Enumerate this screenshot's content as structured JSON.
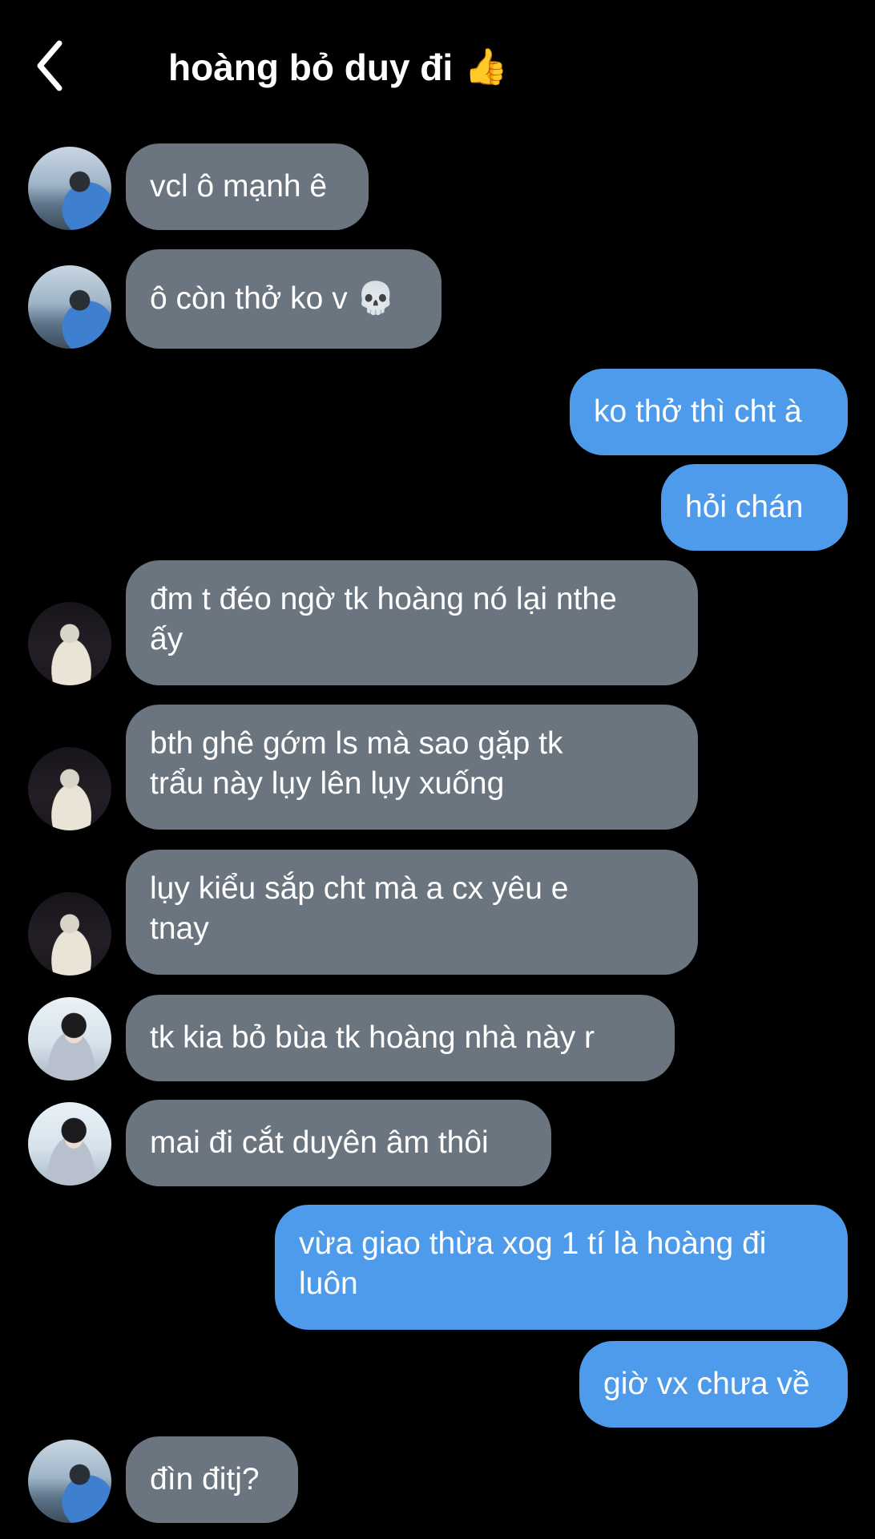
{
  "header": {
    "title": "hoàng bỏ duy đi",
    "title_emoji": "👍",
    "back_icon": "chevron-left-icon"
  },
  "colors": {
    "background": "#000000",
    "incoming_bubble": "#6b7580",
    "outgoing_bubble": "#4d9bea",
    "text": "#ffffff"
  },
  "messages": [
    {
      "side": "in",
      "avatar": "avatar-person-1",
      "text": "vcl ô mạnh ê"
    },
    {
      "side": "in",
      "avatar": "avatar-person-1",
      "text": "ô còn thở ko v 💀"
    },
    {
      "side": "out",
      "text": "ko thở thì cht à"
    },
    {
      "side": "out",
      "text": "hỏi chán"
    },
    {
      "side": "in",
      "avatar": "avatar-person-2",
      "line1": "đm t đéo ngờ tk hoàng nó lại nthe",
      "line2": "ấy"
    },
    {
      "side": "in",
      "avatar": "avatar-person-2",
      "line1": "bth ghê gớm ls mà sao gặp tk",
      "line2": "trẩu này lụy lên lụy xuống"
    },
    {
      "side": "in",
      "avatar": "avatar-person-2",
      "line1": "lụy kiểu sắp cht mà a cx yêu e",
      "line2": "tnay"
    },
    {
      "side": "in",
      "avatar": "avatar-person-3",
      "text": "tk kia bỏ bùa tk hoàng nhà này r"
    },
    {
      "side": "in",
      "avatar": "avatar-person-3",
      "text": "mai đi cắt duyên âm thôi"
    },
    {
      "side": "out",
      "line1": "vừa giao thừa xog 1 tí là hoàng đi",
      "line2": "luôn"
    },
    {
      "side": "out",
      "text": "giờ vx chưa về"
    },
    {
      "side": "in",
      "avatar": "avatar-person-1",
      "text": "đìn đitj?"
    }
  ]
}
